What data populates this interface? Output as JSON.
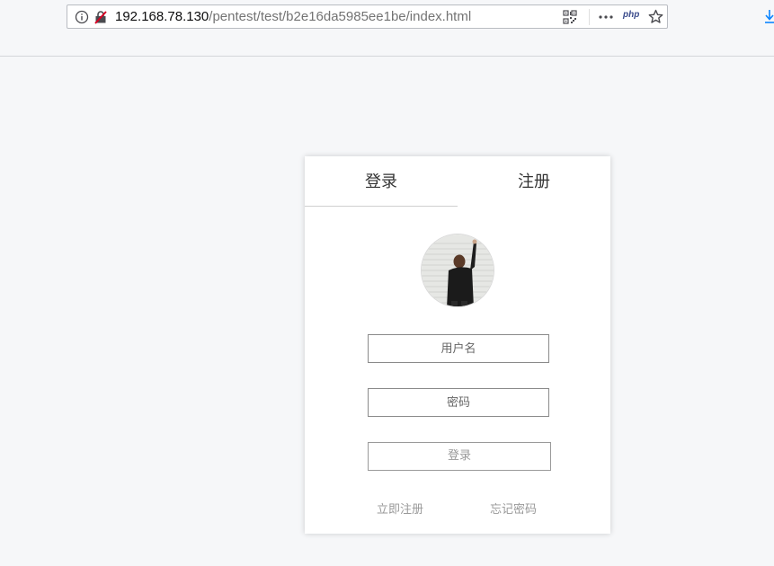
{
  "browser": {
    "url_host": "192.168.78.130",
    "url_path": "/pentest/test/b2e16da5985ee1be/index.html",
    "php_badge": "php",
    "icons": [
      "info-icon",
      "insecure-lock-icon",
      "qr-code-icon",
      "more-actions-icon",
      "php-extension-icon",
      "bookmark-star-icon",
      "download-icon"
    ]
  },
  "card": {
    "tabs": {
      "login": "登录",
      "register": "注册"
    },
    "username_placeholder": "用户名",
    "password_placeholder": "密码",
    "submit_label": "登录",
    "register_link": "立即注册",
    "forgot_link": "忘记密码"
  },
  "colors": {
    "page_bg": "#f6f7f9",
    "card_bg": "#ffffff",
    "muted_text": "#999999",
    "field_border": "#8a8a8a"
  }
}
